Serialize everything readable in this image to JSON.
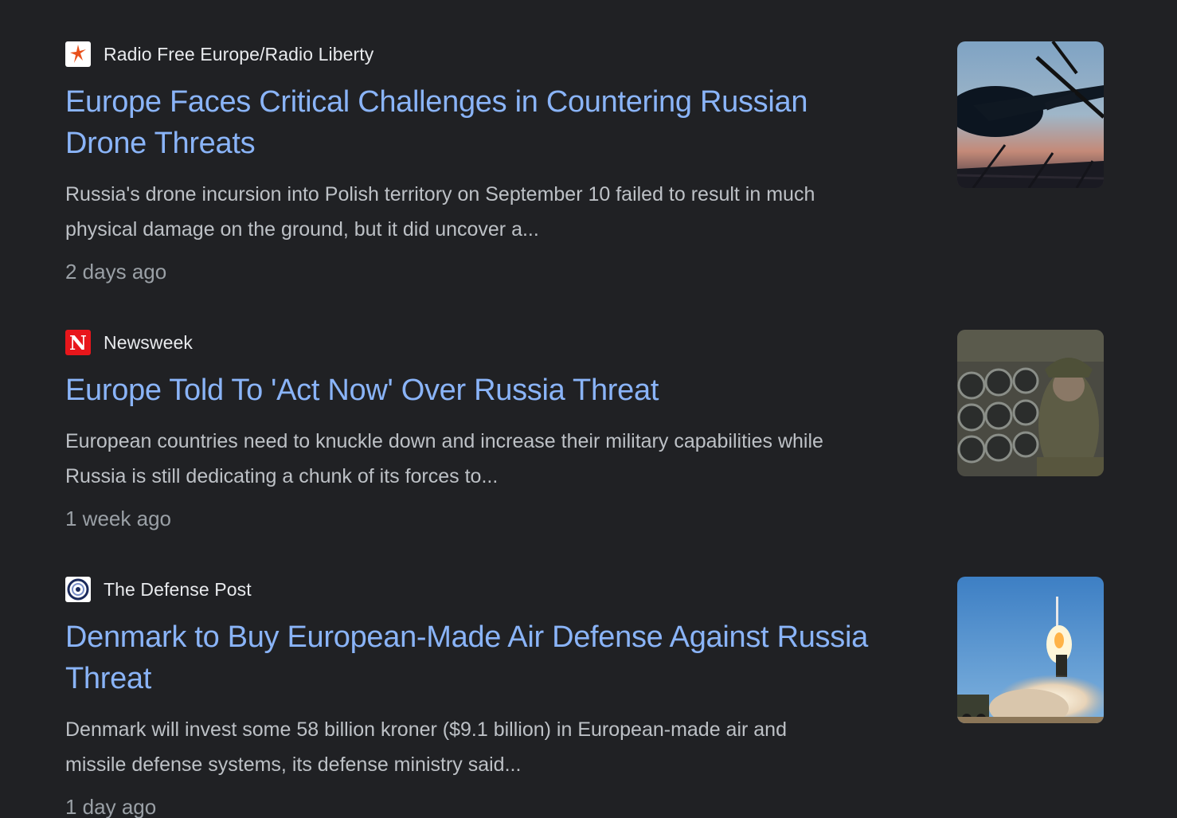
{
  "articles": [
    {
      "source": "Radio Free Europe/Radio Liberty",
      "favicon_icon": "rferl-icon",
      "headline_line1": "Europe Faces Critical Challenges in Countering Russian",
      "headline_line2": "Drone Threats",
      "snippet_line1": "Russia's drone incursion into Polish territory on September 10 failed to result in much",
      "snippet_line2": "physical damage on the ground, but it did uncover a...",
      "time": "2 days ago",
      "thumbnail_icon": "drone-thumbnail"
    },
    {
      "source": "Newsweek",
      "favicon_icon": "newsweek-icon",
      "headline_line1": "Europe Told To 'Act Now' Over Russia Threat",
      "headline_line2": "",
      "snippet_line1": "European countries need to knuckle down and increase their military capabilities while",
      "snippet_line2": "Russia is still dedicating a chunk of its forces to...",
      "time": "1 week ago",
      "thumbnail_icon": "rocket-launcher-thumbnail"
    },
    {
      "source": "The Defense Post",
      "favicon_icon": "defense-post-icon",
      "headline_line1": "Denmark to Buy European-Made Air Defense Against Russia",
      "headline_line2": "Threat",
      "snippet_line1": "Denmark will invest some 58 billion kroner ($9.1 billion) in European-made air and",
      "snippet_line2": "missile defense systems, its defense ministry said...",
      "time": "1 day ago",
      "thumbnail_icon": "missile-launch-thumbnail"
    }
  ],
  "colors": {
    "background": "#202124",
    "headline": "#8ab4f8",
    "source": "#e8eaed",
    "snippet": "#bdc1c6",
    "timestamp": "#9aa0a6"
  }
}
